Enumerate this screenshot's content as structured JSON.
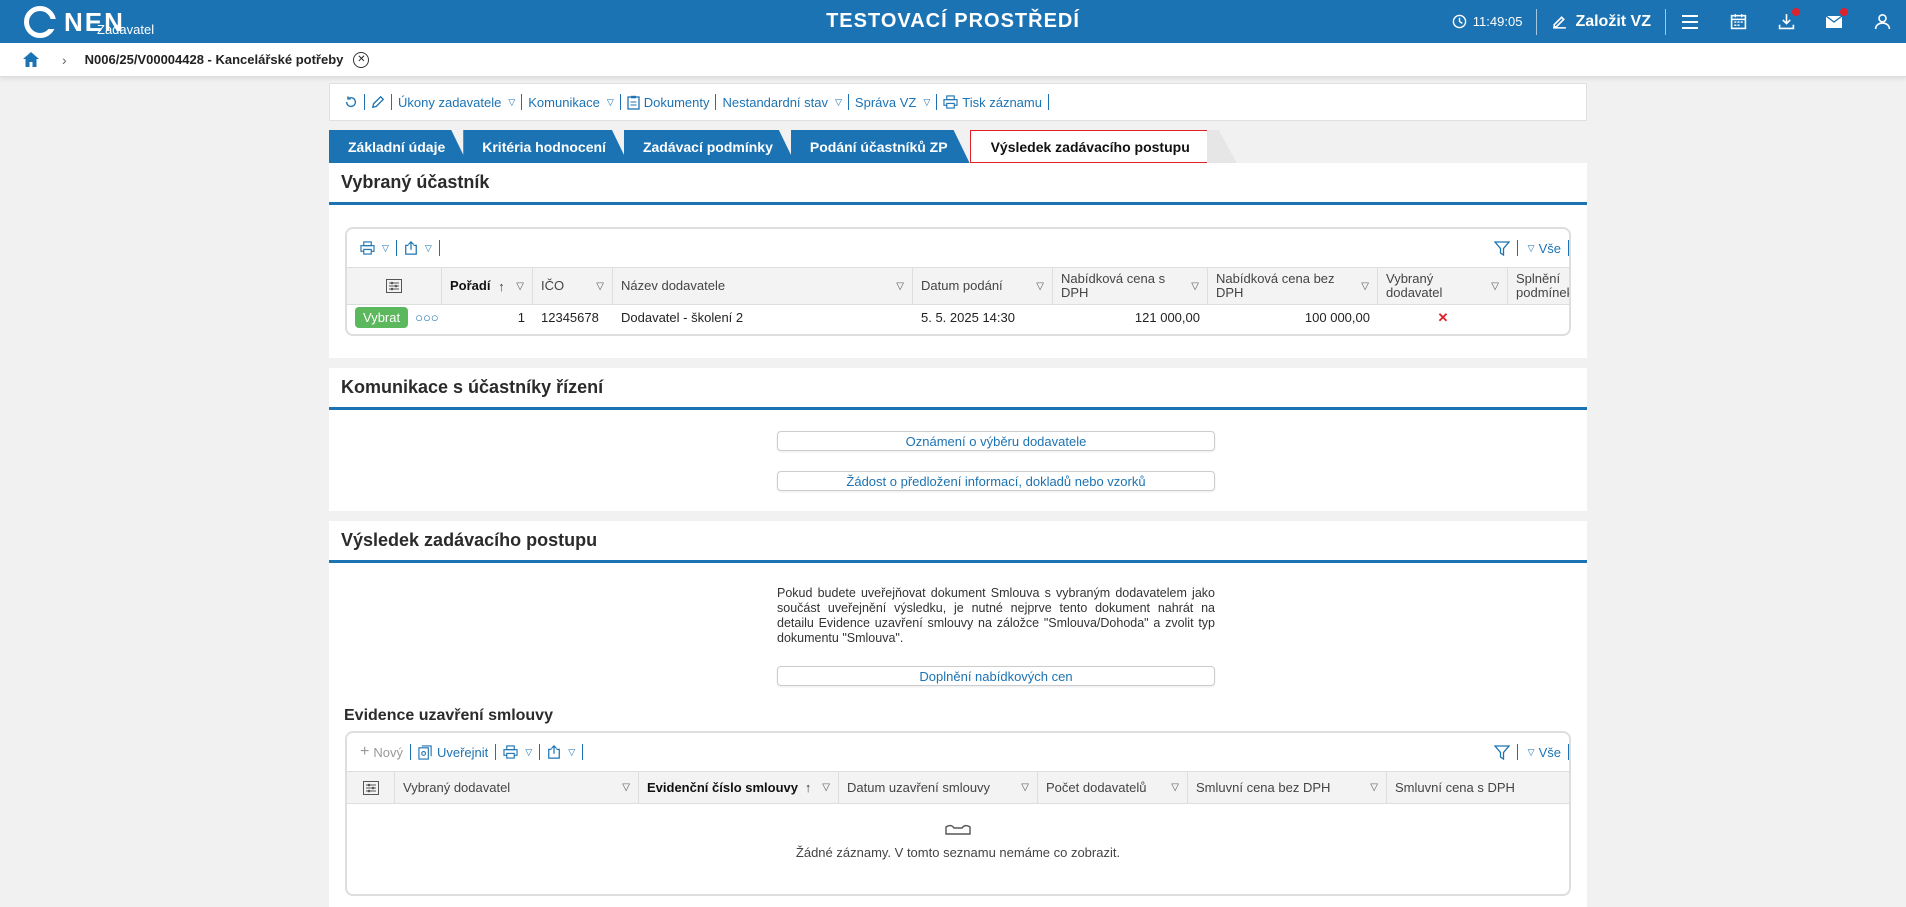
{
  "header": {
    "logo_text": "NEN",
    "logo_sub": "Zadavatel",
    "env_title": "TESTOVACÍ PROSTŘEDÍ",
    "time": "11:49:05",
    "new_vz": "Založit VZ",
    "brand_color": "#1c73b3"
  },
  "breadcrumb": {
    "title": "N006/25/V00004428 - Kancelářské potřeby"
  },
  "toolbar": {
    "items": [
      "Úkony zadavatele",
      "Komunikace",
      "Dokumenty",
      "Nestandardní stav",
      "Správa VZ",
      "Tisk záznamu"
    ]
  },
  "tabs": [
    "Základní údaje",
    "Kritéria hodnocení",
    "Zadávací podmínky",
    "Podání účastníků ZP",
    "Výsledek zadávacího postupu"
  ],
  "selected": {
    "heading": "Vybraný účastník",
    "all_label": "Vše",
    "columns": [
      "Pořadí",
      "IČO",
      "Název dodavatele",
      "Datum podání",
      "Nabídková cena s DPH",
      "Nabídková cena bez DPH",
      "Vybraný dodavatel",
      "Splnění podmínek"
    ],
    "row": {
      "button": "Vybrat",
      "poradi": "1",
      "ico": "12345678",
      "nazev": "Dodavatel - školení 2",
      "datum": "5. 5. 2025 14:30",
      "cena_s": "121 000,00",
      "cena_bez": "100 000,00",
      "vybrany": "✕"
    }
  },
  "communication": {
    "heading": "Komunikace s účastníky řízení",
    "btn1": "Oznámení o výběru dodavatele",
    "btn2": "Žádost o předložení informací, dokladů nebo vzorků"
  },
  "result": {
    "heading": "Výsledek zadávacího postupu",
    "info": "Pokud budete uveřejňovat dokument Smlouva s vybraným dodavatelem jako součást uveřejnění výsledku, je nutné nejprve tento dokument nahrát na detailu Evidence uzavření smlouvy na záložce \"Smlouva/Dohoda\" a zvolit typ dokumentu \"Smlouva\".",
    "btn": "Doplnění nabídkových cen",
    "sub_heading": "Evidence uzavření smlouvy",
    "new_label": "Nový",
    "publish_label": "Uveřejnit",
    "all_label": "Vše",
    "columns": [
      "Vybraný dodavatel",
      "Evidenční číslo smlouvy",
      "Datum uzavření smlouvy",
      "Počet dodavatelů",
      "Smluvní cena bez DPH",
      "Smluvní cena s DPH"
    ],
    "empty": "Žádné záznamy. V tomto seznamu nemáme co zobrazit."
  }
}
